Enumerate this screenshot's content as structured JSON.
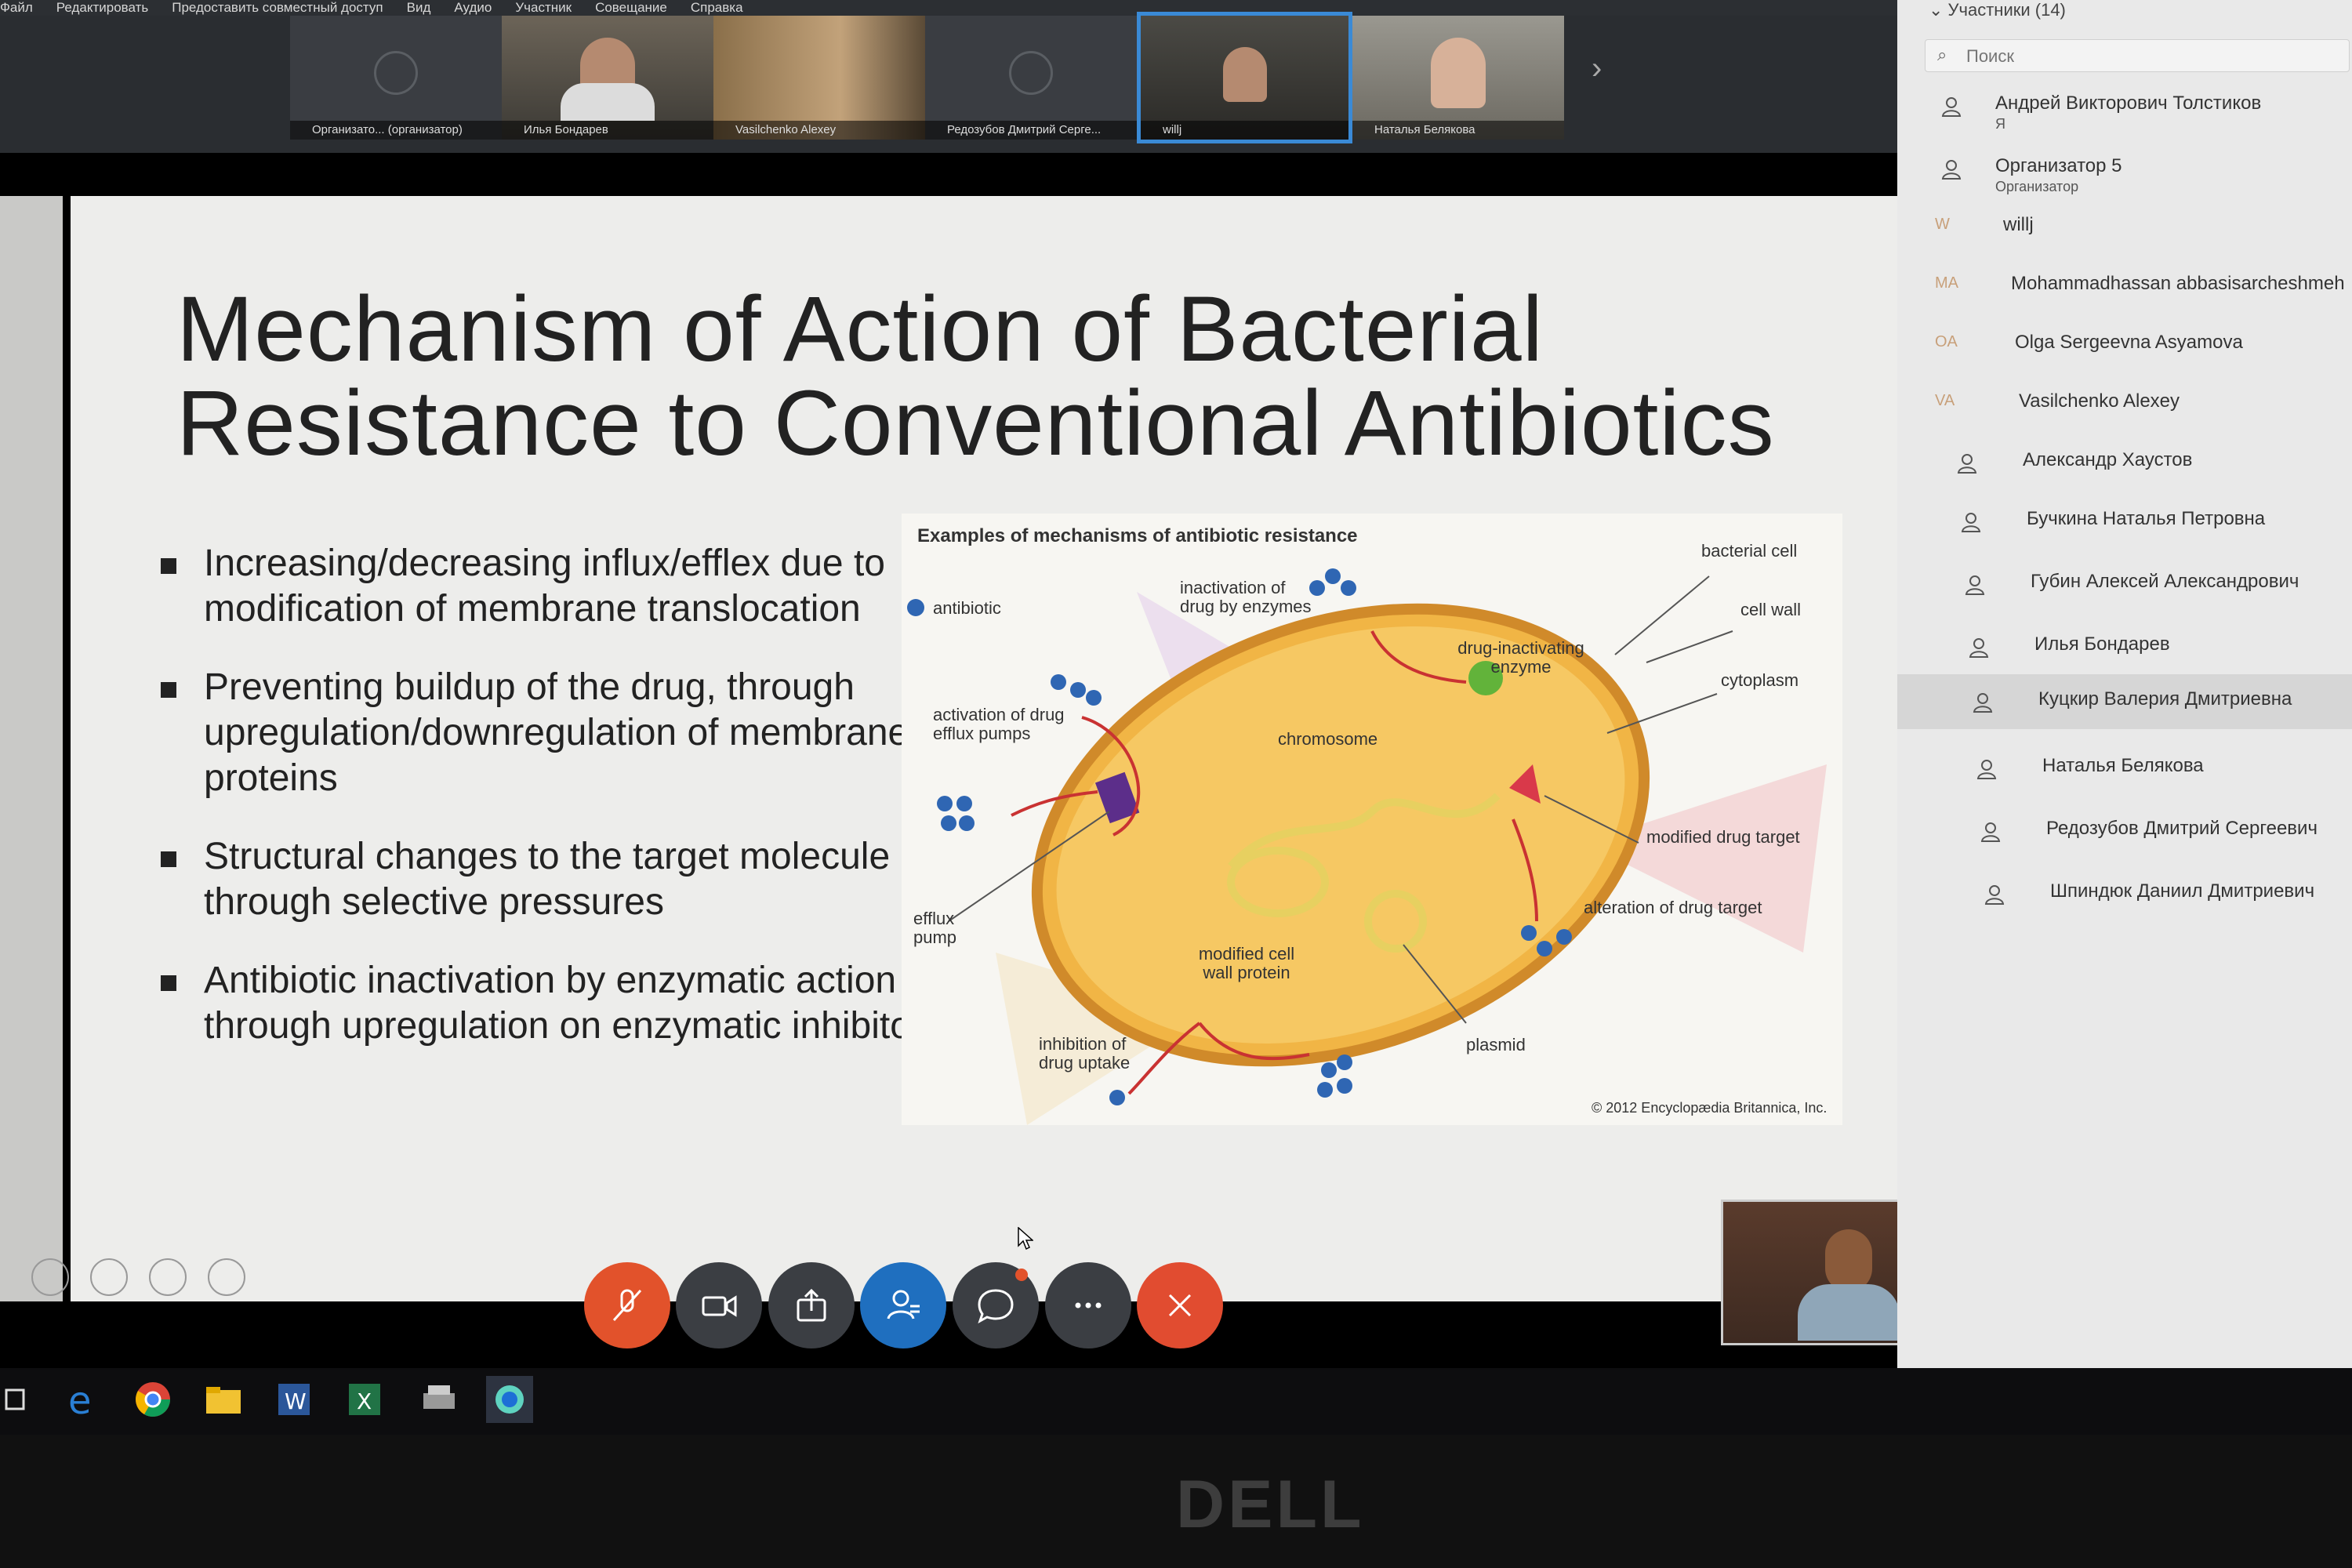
{
  "menu": [
    "Файл",
    "Редактировать",
    "Предоставить совместный доступ",
    "Вид",
    "Аудио",
    "Участник",
    "Совещание",
    "Справка"
  ],
  "video_tiles": [
    {
      "label": "Организато... (организатор)"
    },
    {
      "label": "Илья Бондарев"
    },
    {
      "label": "Vasilchenko Alexey"
    },
    {
      "label": "Редозубов Дмитрий Серге..."
    },
    {
      "label": "willj"
    },
    {
      "label": "Наталья Белякова"
    }
  ],
  "slide": {
    "title_line1": "Mechanism of Action of Bacterial",
    "title_line2": "Resistance to Conventional Antibiotics",
    "bullets": [
      "Increasing/decreasing influx/efflex due to modification of membrane translocation",
      "Preventing buildup of the drug, through upregulation/downregulation of membrane proteins",
      "Structural changes to the target molecule through selective pressures",
      "Antibiotic inactivation by enzymatic action through upregulation on enzymatic inhibitors"
    ]
  },
  "diagram": {
    "title": "Examples of mechanisms of antibiotic resistance",
    "antibiotic": "antibiotic",
    "inactivation": "inactivation of drug by enzymes",
    "activation": "activation of drug efflux pumps",
    "chromosome": "chromosome",
    "drug_inactivating": "drug-inactivating enzyme",
    "bacterial_cell": "bacterial cell",
    "cell_wall": "cell wall",
    "cytoplasm": "cytoplasm",
    "modified_drug_target": "modified drug target",
    "alteration": "alteration of drug target",
    "efflux_pump": "efflux pump",
    "modified_cell_wall": "modified cell wall protein",
    "inhibition": "inhibition of drug uptake",
    "plasmid": "plasmid",
    "copyright": "© 2012 Encyclopædia Britannica, Inc."
  },
  "panel": {
    "header": "Участники (14)",
    "search_placeholder": "Поиск",
    "participants": [
      {
        "name": "Андрей Викторович Толстиков",
        "sub": "Я",
        "initials": ""
      },
      {
        "name": "Организатор 5",
        "sub": "Организатор",
        "initials": ""
      },
      {
        "name": "willj",
        "sub": "",
        "initials": "W"
      },
      {
        "name": "Mohammadhassan abbasisarcheshmeh",
        "sub": "",
        "initials": "MA"
      },
      {
        "name": "Olga Sergeevna Asyamova",
        "sub": "",
        "initials": "OA"
      },
      {
        "name": "Vasilchenko Alexey",
        "sub": "",
        "initials": "VA"
      },
      {
        "name": "Александр Хаустов",
        "sub": "",
        "initials": ""
      },
      {
        "name": "Бучкина Наталья Петровна",
        "sub": "",
        "initials": ""
      },
      {
        "name": "Губин Алексей Александрович",
        "sub": "",
        "initials": ""
      },
      {
        "name": "Илья Бондарев",
        "sub": "",
        "initials": ""
      },
      {
        "name": "Куцкир Валерия Дмитриевна",
        "sub": "",
        "initials": ""
      },
      {
        "name": "Наталья Белякова",
        "sub": "",
        "initials": ""
      },
      {
        "name": "Редозубов Дмитрий Сергеевич",
        "sub": "",
        "initials": ""
      },
      {
        "name": "Шпиндюк Даниил Дмитриевич",
        "sub": "",
        "initials": ""
      }
    ]
  },
  "taskbar_icons": [
    "task-view-icon",
    "edge-icon",
    "chrome-icon",
    "file-explorer-icon",
    "word-icon",
    "excel-icon",
    "printer-app-icon",
    "webex-icon"
  ],
  "monitor_logo": "DELL",
  "colors": {
    "mute": "#e2522b",
    "leave": "#e14c30",
    "participants": "#1f6fbf",
    "highlight": "#d6d6d6"
  }
}
